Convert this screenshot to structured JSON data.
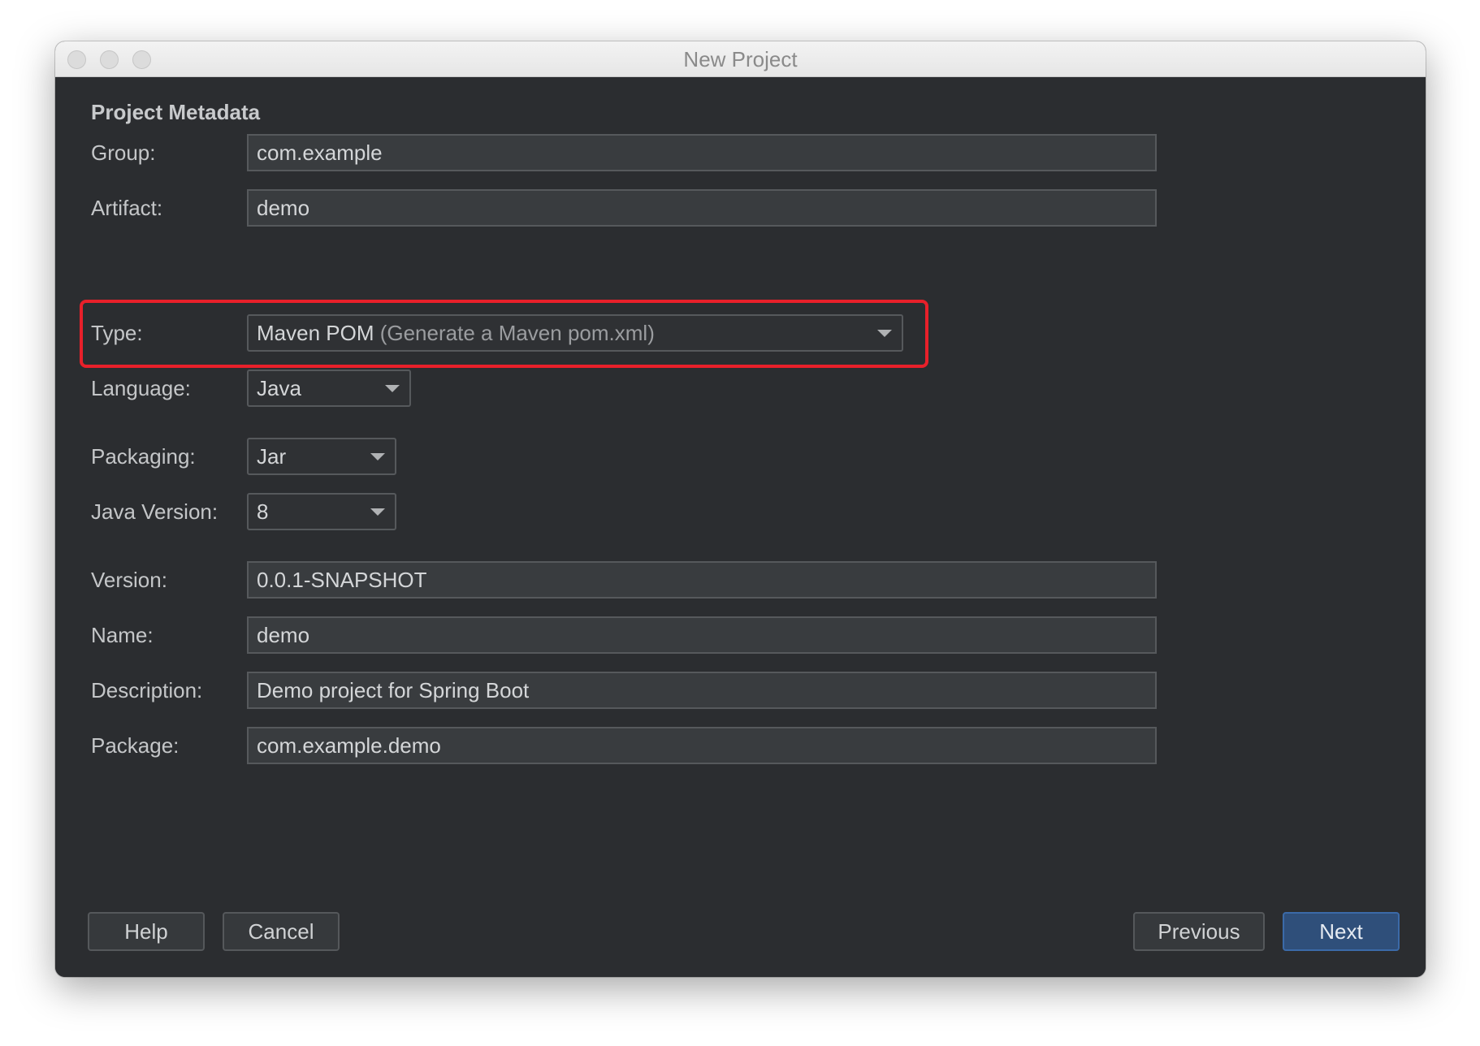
{
  "window": {
    "title": "New Project"
  },
  "section": {
    "title": "Project Metadata"
  },
  "fields": {
    "group": {
      "label": "Group:",
      "value": "com.example"
    },
    "artifact": {
      "label": "Artifact:",
      "value": "demo"
    },
    "type": {
      "label": "Type:",
      "value": "Maven POM",
      "hint": "(Generate a Maven pom.xml)"
    },
    "language": {
      "label": "Language:",
      "value": "Java"
    },
    "packaging": {
      "label": "Packaging:",
      "value": "Jar"
    },
    "java_version": {
      "label": "Java Version:",
      "value": "8"
    },
    "version": {
      "label": "Version:",
      "value": "0.0.1-SNAPSHOT"
    },
    "name": {
      "label": "Name:",
      "value": "demo"
    },
    "description": {
      "label": "Description:",
      "value": "Demo project for Spring Boot"
    },
    "package": {
      "label": "Package:",
      "value": "com.example.demo"
    }
  },
  "buttons": {
    "help": "Help",
    "cancel": "Cancel",
    "previous": "Previous",
    "next": "Next"
  },
  "colors": {
    "background": "#2b2d30",
    "highlight": "#e8202a",
    "primary_button": "#2f4f7a"
  }
}
